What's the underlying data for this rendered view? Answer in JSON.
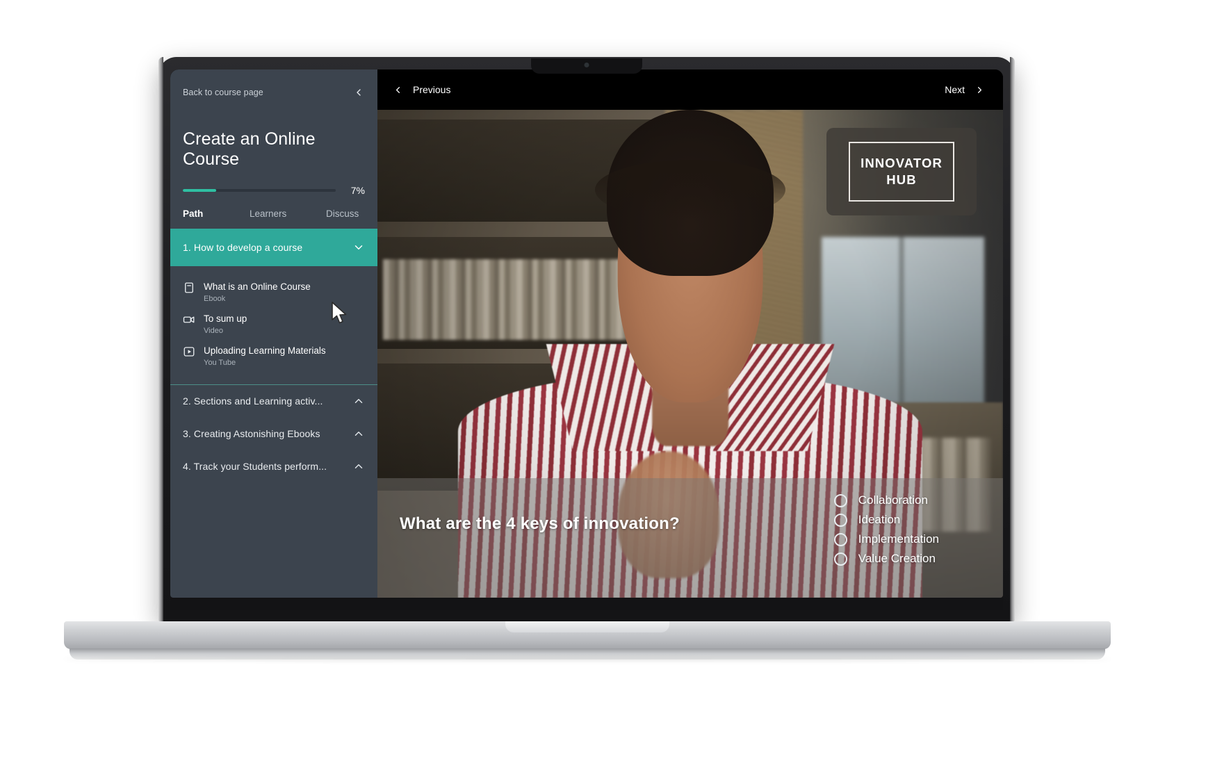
{
  "sidebar": {
    "back_link": "Back to course page",
    "collapse_icon": "chevron-left-icon",
    "course_title": "Create an Online Course",
    "progress": {
      "percent_label": "7%",
      "percent_value": 7,
      "fill_color": "#2fbfa2",
      "track_color": "#2d343d"
    },
    "tabs": [
      {
        "label": "Path",
        "active": true
      },
      {
        "label": "Learners",
        "active": false
      },
      {
        "label": "Discuss",
        "active": false
      }
    ],
    "active_section": {
      "label": "1. How to develop a course",
      "expanded": true,
      "chevron_icon": "chevron-down-icon",
      "accent_color": "#2fa99a"
    },
    "lessons": [
      {
        "title": "What is an Online Course",
        "type": "Ebook",
        "icon": "book-icon"
      },
      {
        "title": "To sum up",
        "type": "Video",
        "icon": "video-camera-icon"
      },
      {
        "title": "Uploading Learning Materials",
        "type": "You Tube",
        "icon": "play-square-icon"
      }
    ],
    "collapsed_sections": [
      {
        "label": "2. Sections and Learning activ...",
        "chevron_icon": "chevron-up-icon"
      },
      {
        "label": "3. Creating Astonishing Ebooks",
        "chevron_icon": "chevron-up-icon"
      },
      {
        "label": "4. Track your Students perform...",
        "chevron_icon": "chevron-up-icon"
      }
    ],
    "bg_color": "#3c444e"
  },
  "topbar": {
    "previous": {
      "label": "Previous",
      "icon": "chevron-left-icon"
    },
    "next": {
      "label": "Next",
      "icon": "chevron-right-icon"
    }
  },
  "video": {
    "logo": {
      "line1": "INNOVATOR",
      "line2": "HUB"
    },
    "lower_third": {
      "question": "What are the 4 keys of innovation?",
      "keys": [
        {
          "label": "Collaboration",
          "marker": "circle-outline-icon"
        },
        {
          "label": "Ideation",
          "marker": "circle-outline-icon"
        },
        {
          "label": "Implementation",
          "marker": "circle-outline-icon"
        },
        {
          "label": "Value Creation",
          "marker": "circle-outline-icon"
        }
      ]
    }
  },
  "cursor": {
    "icon": "mouse-pointer-icon"
  }
}
